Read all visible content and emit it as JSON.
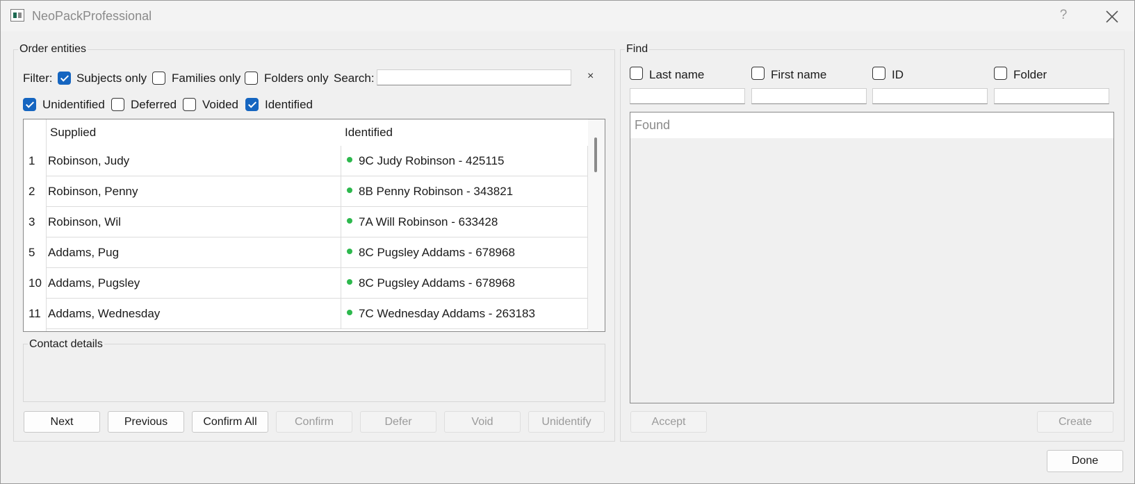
{
  "window": {
    "title": "NeoPackProfessional",
    "help_glyph": "?"
  },
  "order": {
    "title": "Order entities",
    "filter_label": "Filter:",
    "filters": [
      {
        "label": "Subjects only",
        "checked": true
      },
      {
        "label": "Families only",
        "checked": false
      },
      {
        "label": "Folders only",
        "checked": false
      }
    ],
    "search_label": "Search:",
    "search_value": "",
    "clear_glyph": "×",
    "status_filters": [
      {
        "label": "Unidentified",
        "checked": true
      },
      {
        "label": "Deferred",
        "checked": false
      },
      {
        "label": "Voided",
        "checked": false
      },
      {
        "label": "Identified",
        "checked": true
      }
    ],
    "table": {
      "columns": [
        "Supplied",
        "Identified"
      ],
      "rows": [
        {
          "num": "1",
          "supplied": "Robinson, Judy",
          "identified": "9C Judy Robinson - 425115"
        },
        {
          "num": "2",
          "supplied": "Robinson, Penny",
          "identified": "8B Penny Robinson - 343821"
        },
        {
          "num": "3",
          "supplied": "Robinson, Wil",
          "identified": "7A Will Robinson - 633428"
        },
        {
          "num": "5",
          "supplied": "Addams, Pug",
          "identified": "8C Pugsley Addams - 678968"
        },
        {
          "num": "10",
          "supplied": "Addams, Pugsley",
          "identified": "8C Pugsley Addams - 678968"
        },
        {
          "num": "11",
          "supplied": "Addams, Wednesday",
          "identified": "7C Wednesday Addams - 263183"
        }
      ],
      "status_color": "#2db84d"
    },
    "contact_title": "Contact details",
    "buttons": {
      "next": "Next",
      "previous": "Previous",
      "confirm_all": "Confirm All",
      "confirm": "Confirm",
      "defer": "Defer",
      "void": "Void",
      "unidentify": "Unidentify"
    }
  },
  "find": {
    "title": "Find",
    "fields": [
      {
        "label": "Last name",
        "checked": false,
        "value": ""
      },
      {
        "label": "First name",
        "checked": false,
        "value": ""
      },
      {
        "label": "ID",
        "checked": false,
        "value": ""
      },
      {
        "label": "Folder",
        "checked": false,
        "value": ""
      }
    ],
    "found_header": "Found",
    "accept": "Accept",
    "create": "Create"
  },
  "done": "Done",
  "colors": {
    "accent": "#1565c0",
    "dialog_bg": "#f0f0f0",
    "disabled_text": "#9a9a9a"
  }
}
